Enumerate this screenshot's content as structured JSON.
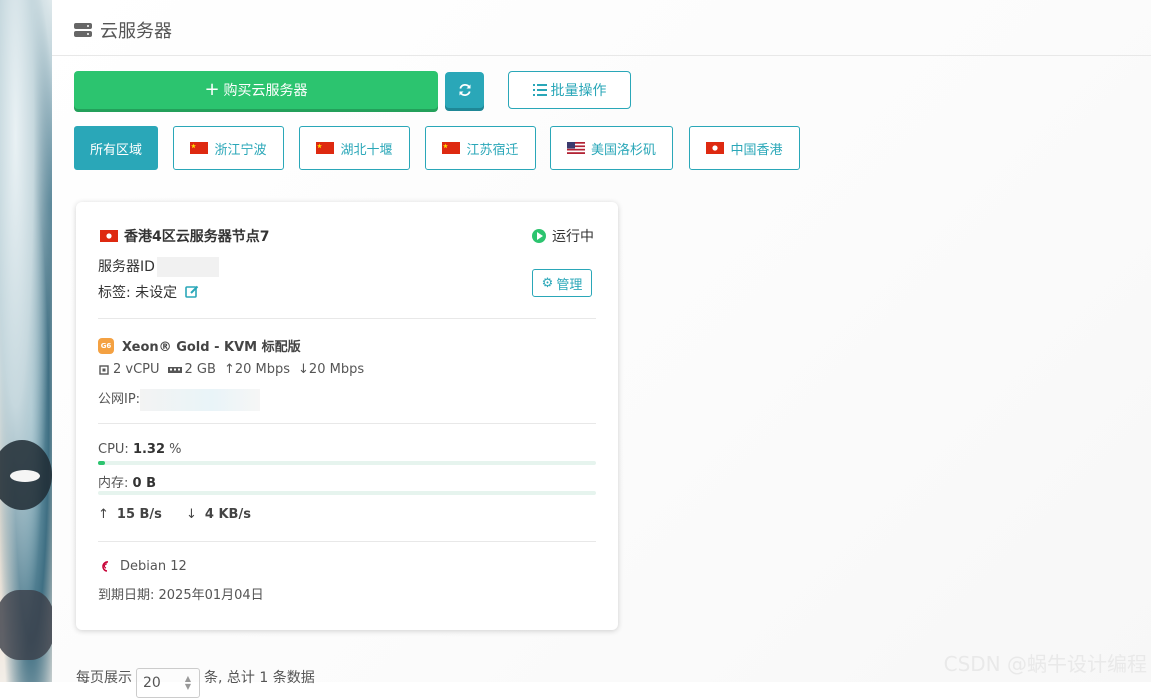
{
  "page": {
    "title": "云服务器"
  },
  "toolbar": {
    "buy_label": "购买云服务器",
    "batch_label": "批量操作"
  },
  "regions": [
    {
      "label": "所有区域"
    },
    {
      "label": "浙江宁波",
      "flag": "CN"
    },
    {
      "label": "湖北十堰",
      "flag": "CN"
    },
    {
      "label": "江苏宿迁",
      "flag": "CN"
    },
    {
      "label": "美国洛杉矶",
      "flag": "US"
    },
    {
      "label": "中国香港",
      "flag": "HK"
    }
  ],
  "server": {
    "name": "香港4区云服务器节点7",
    "status": "运行中",
    "status_color": "#2cc46f",
    "id_label": "服务器ID",
    "tag_label": "标签: 未设定",
    "manage_label": "管理",
    "spec_title": "Xeon® Gold - KVM 标配版",
    "spec_badge": "G6",
    "cpu": "2 vCPU",
    "ram": "2 GB",
    "up_bandwidth": "20 Mbps",
    "down_bandwidth": "20 Mbps",
    "ip_label": "公网IP:",
    "cpu_label": "CPU:",
    "cpu_value": "1.32",
    "cpu_unit": "%",
    "cpu_percent": 1.32,
    "mem_label": "内存:",
    "mem_value": "0 B",
    "mem_percent": 0,
    "net_up": "15 B/s",
    "net_down": "4 KB/s",
    "os": "Debian 12",
    "expire": "到期日期: 2025年01月04日"
  },
  "pager": {
    "per_page_label": "每页展示",
    "per_page_value": "20",
    "summary": "条, 总计 1 条数据"
  },
  "watermark": "CSDN @蜗牛设计编程",
  "colors": {
    "accent": "#2aa7b8",
    "primary": "#2cc46f"
  }
}
